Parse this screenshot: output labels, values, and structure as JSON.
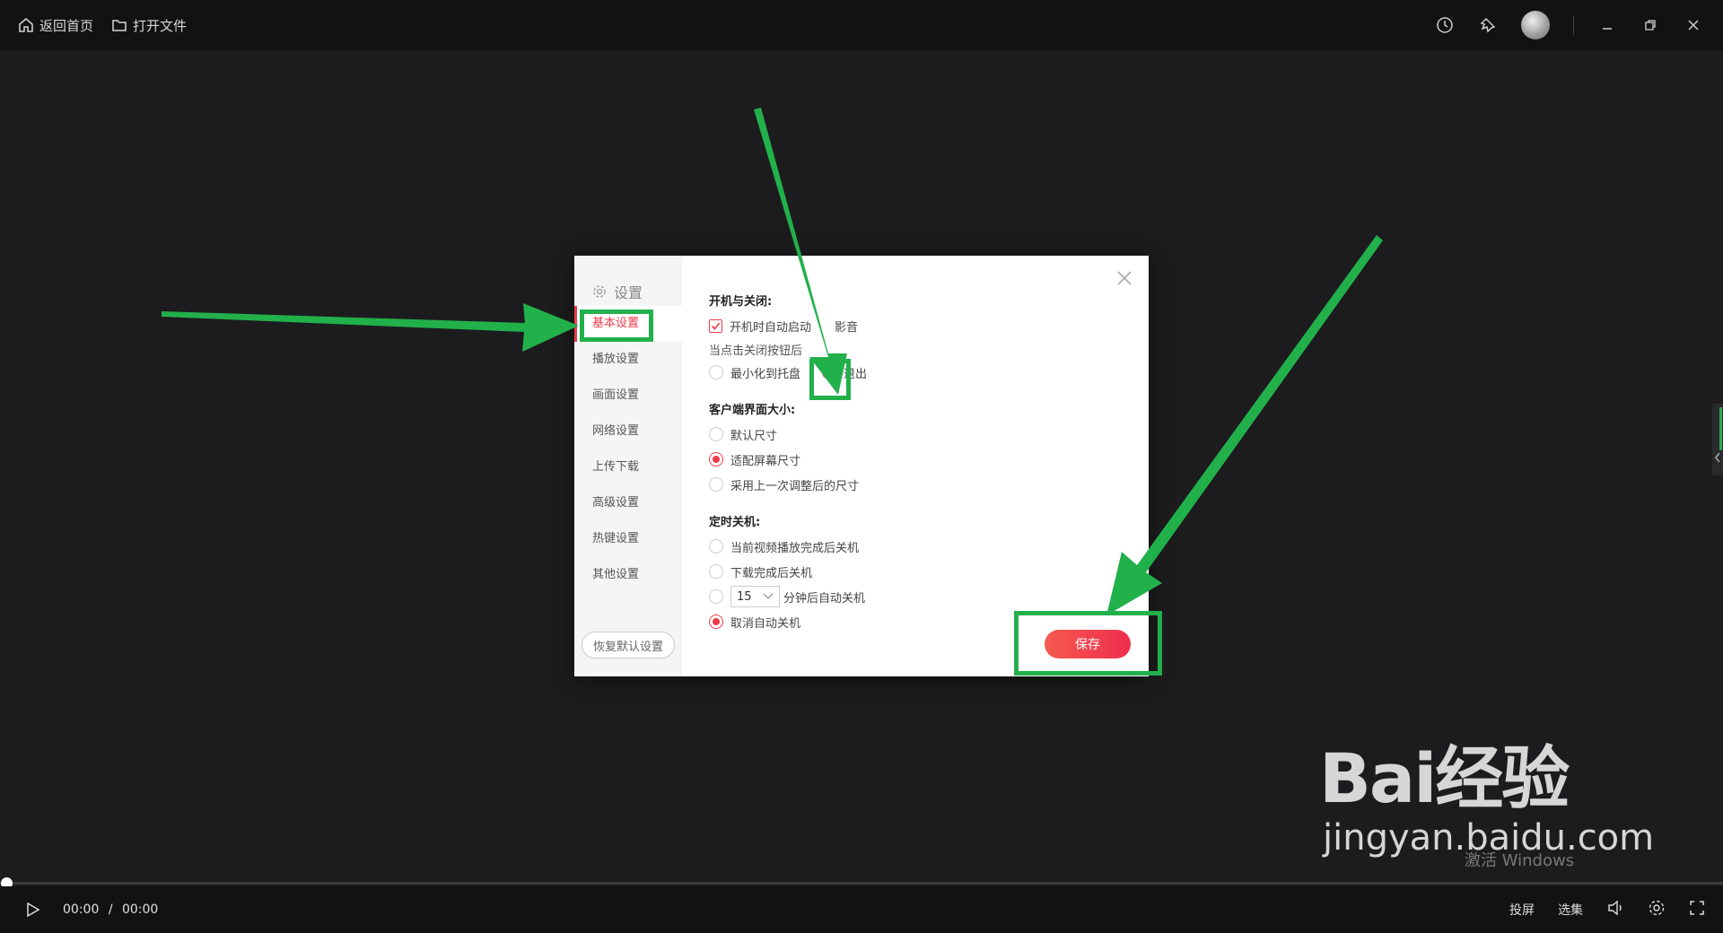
{
  "topbar": {
    "home_label": "返回首页",
    "open_file_label": "打开文件"
  },
  "dialog": {
    "title": "设置",
    "nav": [
      "基本设置",
      "播放设置",
      "画面设置",
      "网络设置",
      "上传下载",
      "高级设置",
      "热键设置",
      "其他设置"
    ],
    "active_nav": "基本设置",
    "restore_label": "恢复默认设置",
    "save_label": "保存",
    "startup": {
      "title": "开机与关闭:",
      "autostart_label": "开机时自动启动",
      "autostart_suffix": "影音",
      "close_prompt": "当点击关闭按钮后",
      "minimize_label": "最小化到托盘",
      "exit_label": "退出"
    },
    "window_size": {
      "title": "客户端界面大小:",
      "options": [
        "默认尺寸",
        "适配屏幕尺寸",
        "采用上一次调整后的尺寸"
      ],
      "selected": "适配屏幕尺寸"
    },
    "shutdown": {
      "title": "定时关机:",
      "opt1": "当前视频播放完成后关机",
      "opt2": "下载完成后关机",
      "minutes_value": "15",
      "opt3_suffix": "分钟后自动关机",
      "opt4": "取消自动关机"
    }
  },
  "player": {
    "current_time": "00:00",
    "separator": "/",
    "total_time": "00:00",
    "cast_label": "投屏",
    "episodes_label": "选集"
  },
  "watermark": {
    "brand": "Bai经验",
    "url": "jingyan.baidu.com",
    "activation": "激活 Windows"
  }
}
